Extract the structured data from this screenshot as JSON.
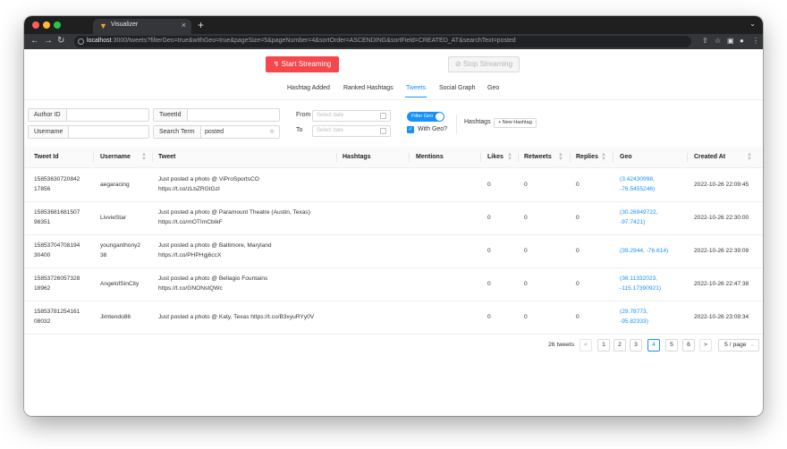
{
  "browser": {
    "tab_title": "Visualizer",
    "url_host": "localhost",
    "url_rest": ":3000/tweets?filterGeo=true&withGeo=true&pageSize=5&pageNumber=4&sortOrder=ASCENDING&sortField=CREATED_AT&searchText=posted",
    "traffic_lights": [
      "#ff5f57",
      "#febc2e",
      "#28c840"
    ]
  },
  "actions": {
    "start_label": "Start Streaming",
    "stop_label": "Stop Streaming"
  },
  "nav": {
    "items": [
      "Hashtag Added",
      "Ranked Hashtags",
      "Tweets",
      "Social Graph",
      "Geo"
    ],
    "active": "Tweets"
  },
  "filters": {
    "author_id_label": "Author ID",
    "author_id_value": "",
    "tweet_id_label": "TweetId",
    "tweet_id_value": "",
    "username_label": "Username",
    "username_value": "",
    "search_term_label": "Search Term",
    "search_term_value": "posted",
    "from_label": "From",
    "to_label": "To",
    "date_placeholder": "Select date",
    "filter_geo_label": "Filter Geo",
    "with_geo_label": "With Geo?",
    "hashtags_label": "Hashtags",
    "new_hashtag_label": "+ New Hashtag"
  },
  "table": {
    "columns": [
      "Tweet Id",
      "Username",
      "Tweet",
      "Hashtags",
      "Mentions",
      "Likes",
      "Retweets",
      "Replies",
      "Geo",
      "Created At"
    ],
    "rows": [
      {
        "id_line1": "15853630720842",
        "id_line2": "17856",
        "user_line1": "aegaracing",
        "user_line2": "",
        "tweet_line1": "Just posted a photo @ ViProSportsCO",
        "tweet_line2": "https://t.co/zLbZRGtGzI",
        "likes": "0",
        "retweets": "0",
        "replies": "0",
        "geo_line1": "(3.42430998,",
        "geo_line2": "-76.5455246)",
        "created": "2022-10-26 22:09:45"
      },
      {
        "id_line1": "15853681681507",
        "id_line2": "98351",
        "user_line1": "LivvieStar",
        "user_line2": "",
        "tweet_line1": "Just posted a photo @ Paramount Theatre (Austin, Texas)",
        "tweet_line2": "https://t.co/mOTImCbIkF",
        "likes": "0",
        "retweets": "0",
        "replies": "0",
        "geo_line1": "(30.26949722,",
        "geo_line2": "-97.7421)",
        "created": "2022-10-26 22:30:00"
      },
      {
        "id_line1": "15853704708194",
        "id_line2": "30400",
        "user_line1": "younganthony2",
        "user_line2": "38",
        "tweet_line1": "Just posted a photo @ Baltimore, Maryland",
        "tweet_line2": "https://t.co/PHPHgj6ccX",
        "likes": "0",
        "retweets": "0",
        "replies": "0",
        "geo_line1": "(39.2944, -76.614)",
        "geo_line2": "",
        "created": "2022-10-26 22:39:09"
      },
      {
        "id_line1": "15853726057328",
        "id_line2": "18962",
        "user_line1": "AngelofSinCity",
        "user_line2": "",
        "tweet_line1": "Just posted a photo @ Bellagio Fountains",
        "tweet_line2": "https://t.co/GNONstQWc",
        "likes": "0",
        "retweets": "0",
        "replies": "0",
        "geo_line1": "(36.11332023,",
        "geo_line2": "-115.17390921)",
        "created": "2022-10-26 22:47:38"
      },
      {
        "id_line1": "15853781254161",
        "id_line2": "08032",
        "user_line1": "Jimtendo86",
        "user_line2": "",
        "tweet_line1": "Just posted a photo @ Katy, Texas https://t.co/B3xyuRYy0V",
        "tweet_line2": "",
        "likes": "0",
        "retweets": "0",
        "replies": "0",
        "geo_line1": "(29.78773,",
        "geo_line2": "-95.82333)",
        "created": "2022-10-26 23:09:34"
      }
    ]
  },
  "pagination": {
    "total": "26 tweets",
    "pages": [
      "1",
      "2",
      "3",
      "4",
      "5",
      "6"
    ],
    "current": "4",
    "prev": "<",
    "next": ">",
    "page_size": "5 / page"
  },
  "colors": {
    "accent": "#1890ff",
    "danger": "#f5474c"
  }
}
